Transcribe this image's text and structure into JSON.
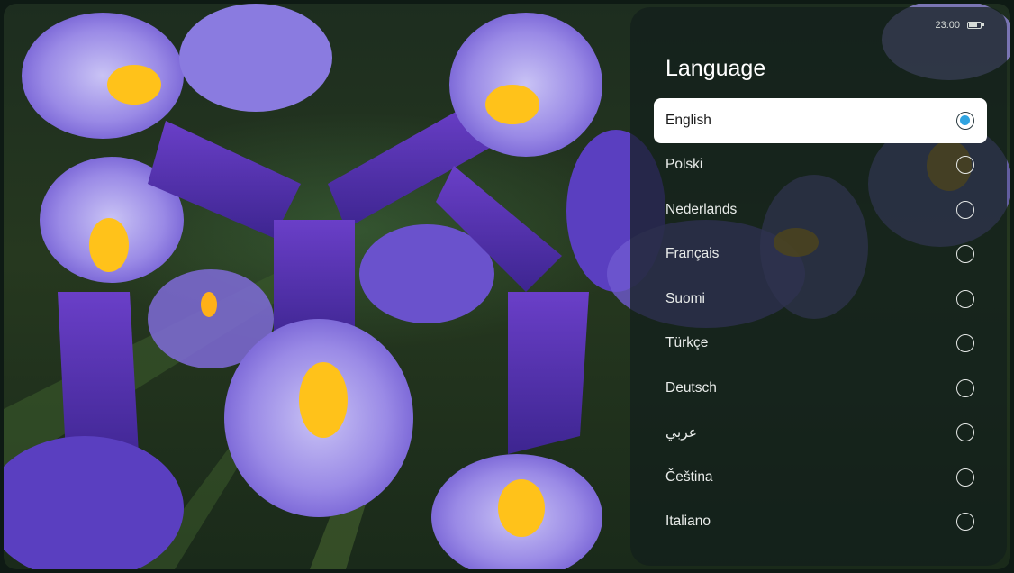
{
  "status": {
    "time": "23:00",
    "battery_icon": "battery-icon"
  },
  "panel": {
    "title": "Language"
  },
  "languages": [
    {
      "label": "English",
      "selected": true
    },
    {
      "label": "Polski",
      "selected": false
    },
    {
      "label": "Nederlands",
      "selected": false
    },
    {
      "label": "Français",
      "selected": false
    },
    {
      "label": "Suomi",
      "selected": false
    },
    {
      "label": "Türkçe",
      "selected": false
    },
    {
      "label": "Deutsch",
      "selected": false
    },
    {
      "label": "عربي",
      "selected": false
    },
    {
      "label": "Čeština",
      "selected": false
    },
    {
      "label": "Italiano",
      "selected": false
    }
  ],
  "colors": {
    "accent": "#2fa3e0",
    "petal": "#8c7ae0",
    "petal_dark": "#5a3fc0",
    "yellow": "#ffc21a"
  }
}
